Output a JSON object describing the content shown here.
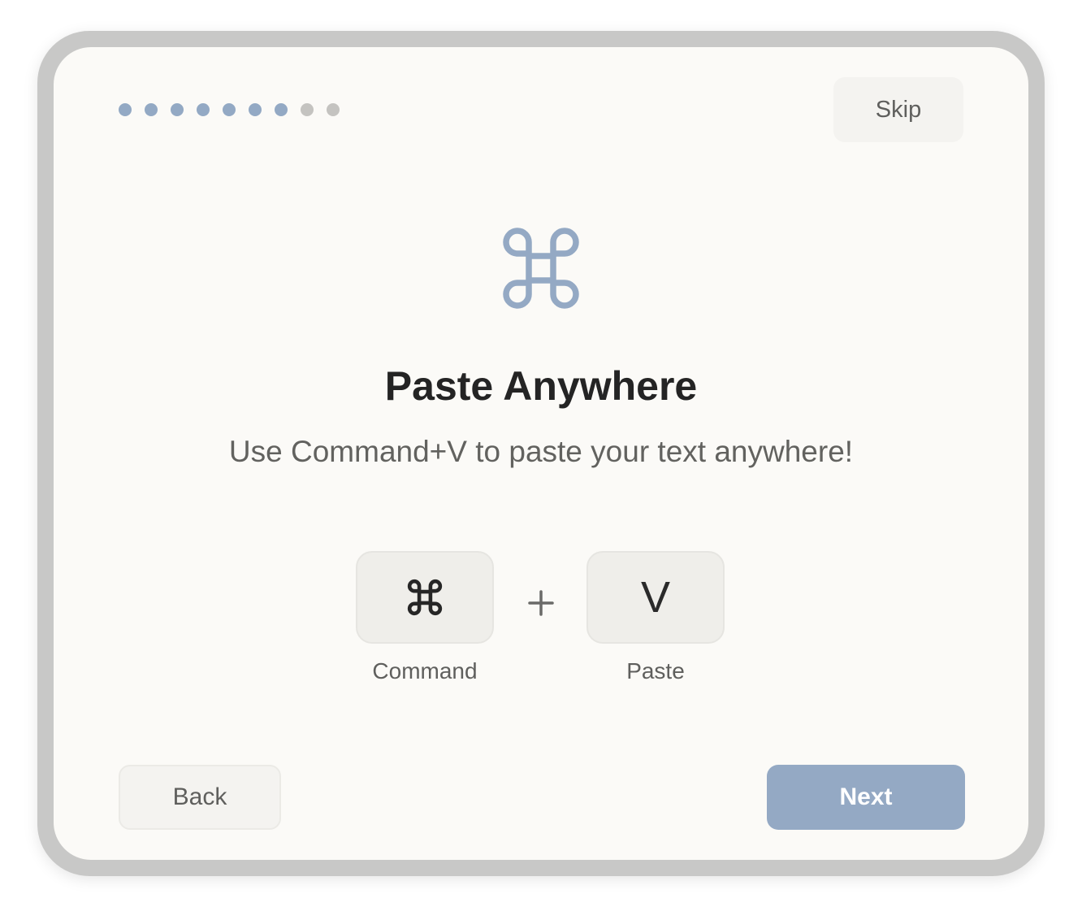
{
  "onboarding": {
    "progress": {
      "total_steps": 9,
      "current_step": 7,
      "active_color": "#93a9c4",
      "inactive_color": "#c4c3c0"
    },
    "skip_label": "Skip",
    "hero_icon": "command-icon",
    "title": "Paste Anywhere",
    "subtitle": "Use Command+V to paste your text anywhere!",
    "shortcut": {
      "keys": [
        {
          "glyph": "⌘",
          "icon": "command-key-icon",
          "label": "Command"
        },
        {
          "glyph": "V",
          "label": "Paste"
        }
      ],
      "separator": "+"
    },
    "back_label": "Back",
    "next_label": "Next",
    "colors": {
      "accent": "#94a9c4",
      "title": "#242424",
      "text": "#62625f",
      "background": "#fbfaf7"
    }
  }
}
